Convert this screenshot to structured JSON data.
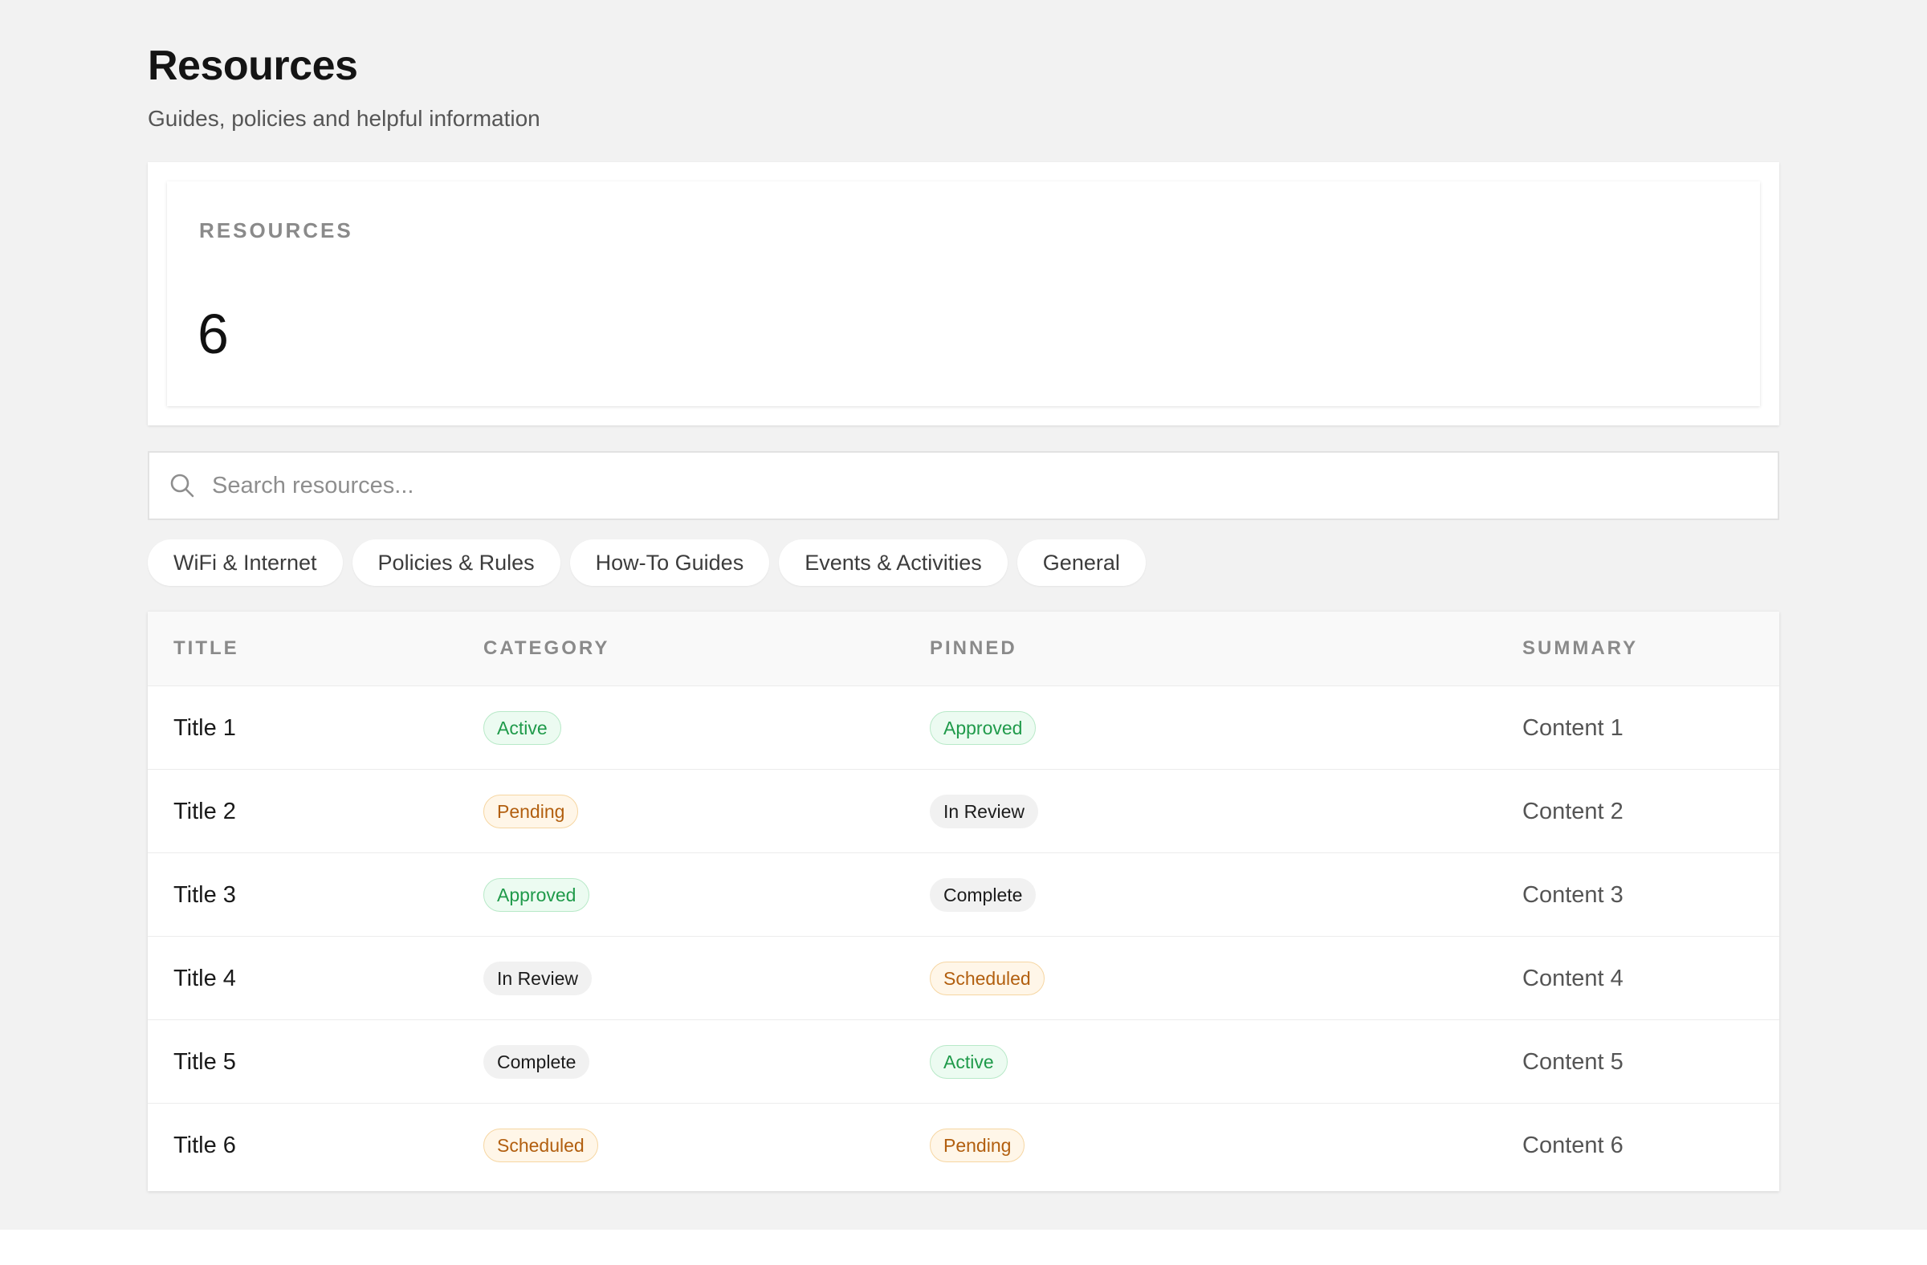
{
  "header": {
    "title": "Resources",
    "subtitle": "Guides, policies and helpful information"
  },
  "stat": {
    "label": "RESOURCES",
    "value": "6"
  },
  "search": {
    "placeholder": "Search resources...",
    "value": ""
  },
  "filters": [
    {
      "label": "WiFi & Internet"
    },
    {
      "label": "Policies & Rules"
    },
    {
      "label": "How-To Guides"
    },
    {
      "label": "Events & Activities"
    },
    {
      "label": "General"
    }
  ],
  "table": {
    "columns": [
      "TITLE",
      "CATEGORY",
      "PINNED",
      "SUMMARY"
    ],
    "rows": [
      {
        "title": "Title 1",
        "category": {
          "label": "Active",
          "tone": "green"
        },
        "pinned": {
          "label": "Approved",
          "tone": "green"
        },
        "summary": "Content 1"
      },
      {
        "title": "Title 2",
        "category": {
          "label": "Pending",
          "tone": "orange"
        },
        "pinned": {
          "label": "In Review",
          "tone": "gray"
        },
        "summary": "Content 2"
      },
      {
        "title": "Title 3",
        "category": {
          "label": "Approved",
          "tone": "green"
        },
        "pinned": {
          "label": "Complete",
          "tone": "gray"
        },
        "summary": "Content 3"
      },
      {
        "title": "Title 4",
        "category": {
          "label": "In Review",
          "tone": "gray"
        },
        "pinned": {
          "label": "Scheduled",
          "tone": "orange"
        },
        "summary": "Content 4"
      },
      {
        "title": "Title 5",
        "category": {
          "label": "Complete",
          "tone": "gray"
        },
        "pinned": {
          "label": "Active",
          "tone": "green"
        },
        "summary": "Content 5"
      },
      {
        "title": "Title 6",
        "category": {
          "label": "Scheduled",
          "tone": "orange"
        },
        "pinned": {
          "label": "Pending",
          "tone": "orange"
        },
        "summary": "Content 6"
      }
    ]
  },
  "colors": {
    "background": "#f2f2f2",
    "badge_green_text": "#1f9a4a",
    "badge_orange_text": "#b25f0f",
    "badge_gray_text": "#1c1c1c"
  },
  "icons": {
    "search": "search-icon"
  }
}
